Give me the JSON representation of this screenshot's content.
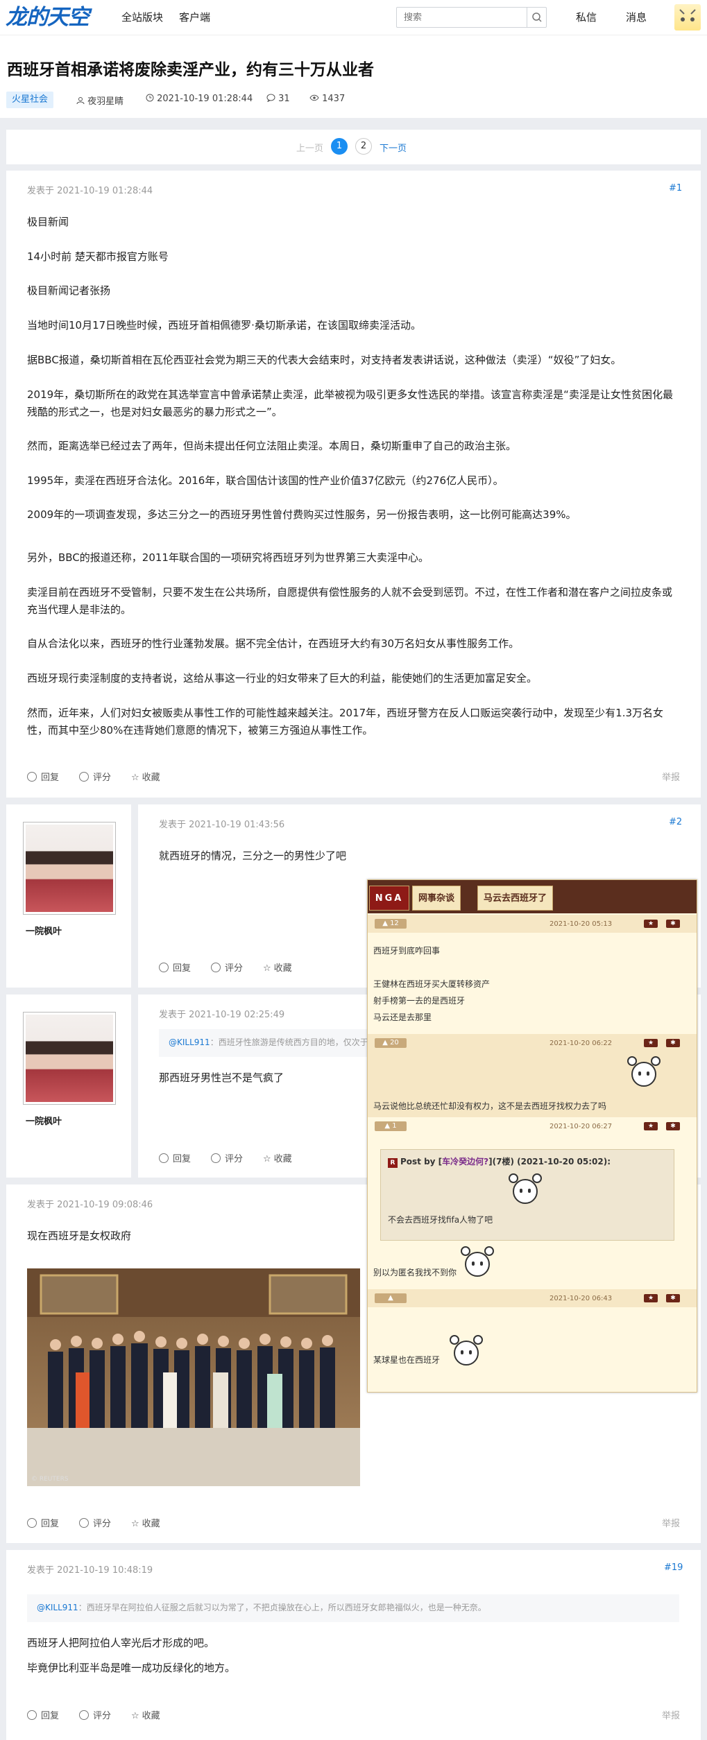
{
  "header": {
    "logo": "龙的天空",
    "nav": [
      "全站版块",
      "客户端"
    ],
    "search_placeholder": "搜索",
    "right": [
      "私信",
      "消息"
    ]
  },
  "thread": {
    "title": "西班牙首相承诺将废除卖淫产业，约有三十万从业者",
    "tag": "火星社会",
    "author": "夜羽星睛",
    "time": "2021-10-19 01:28:44",
    "replies": "31",
    "views": "1437"
  },
  "pager": {
    "prev": "上一页",
    "pages": [
      "1",
      "2"
    ],
    "next": "下一页"
  },
  "actions": {
    "reply": "回复",
    "rate": "评分",
    "fav": "收藏",
    "report": "举报"
  },
  "posts": [
    {
      "posted": "发表于 2021-10-19 01:28:44",
      "floor": "#1",
      "paragraphs": [
        "极目新闻",
        "14小时前 楚天都市报官方账号",
        "极目新闻记者张扬",
        "当地时间10月17日晚些时候，西班牙首相佩德罗·桑切斯承诺，在该国取缔卖淫活动。",
        "据BBC报道，桑切斯首相在瓦伦西亚社会党为期三天的代表大会结束时，对支持者发表讲话说，这种做法（卖淫）“奴役”了妇女。",
        "2019年，桑切斯所在的政党在其选举宣言中曾承诺禁止卖淫，此举被视为吸引更多女性选民的举措。该宣言称卖淫是“卖淫是让女性贫困化最残酷的形式之一，也是对妇女最恶劣的暴力形式之一”。",
        "然而，距离选举已经过去了两年，但尚未提出任何立法阻止卖淫。本周日，桑切斯重申了自己的政治主张。",
        "1995年，卖淫在西班牙合法化。2016年，联合国估计该国的性产业价值37亿欧元（约276亿人民币）。",
        "2009年的一项调查发现，多达三分之一的西班牙男性曾付费购买过性服务，另一份报告表明，这一比例可能高达39%。",
        "另外，BBC的报道还称，2011年联合国的一项研究将西班牙列为世界第三大卖淫中心。",
        "卖淫目前在西班牙不受管制，只要不发生在公共场所，自愿提供有偿性服务的人就不会受到惩罚。不过，在性工作者和潜在客户之间拉皮条或充当代理人是非法的。",
        "自从合法化以来，西班牙的性行业蓬勃发展。据不完全估计，在西班牙大约有30万名妇女从事性服务工作。",
        "西班牙现行卖淫制度的支持者说，这给从事这一行业的妇女带来了巨大的利益，能使她们的生活更加富足安全。",
        "然而，近年来，人们对妇女被贩卖从事性工作的可能性越来越关注。2017年，西班牙警方在反人口贩运突袭行动中，发现至少有1.3万名女性，而其中至少80%在违背她们意愿的情况下，被第三方强迫从事性工作。"
      ]
    },
    {
      "user": "一院枫叶",
      "posted": "发表于 2021-10-19 01:43:56",
      "floor": "#2",
      "text": "就西班牙的情况，三分之一的男性少了吧"
    },
    {
      "user": "一院枫叶",
      "posted": "发表于 2021-10-19 02:25:49",
      "quote_at": "@KILL911",
      "quote": "：西班牙性旅游是传统西方目的地，仅次于",
      "text": "那西班牙男性岂不是气疯了"
    },
    {
      "posted": "发表于 2021-10-19 09:08:46",
      "text": "现在西班牙是女权政府",
      "photo_credit": "© REUTERS"
    },
    {
      "posted": "发表于 2021-10-19 10:48:19",
      "floor": "#19",
      "quote_at": "@KILL911",
      "quote": "：西班牙早在阿拉伯人征服之后就习以为常了，不把贞操放在心上，所以西班牙女郎艳福似火，也是一种无奈。",
      "lines": [
        "西班牙人把阿拉伯人宰光后才形成的吧。",
        "毕竟伊比利亚半岛是唯一成功反绿化的地方。"
      ]
    }
  ],
  "nga": {
    "logo": "NGA",
    "tabs": [
      "网事杂谈",
      "马云去西班牙了"
    ],
    "rows": [
      {
        "likes": "12",
        "time": "2021-10-20 05:13",
        "lines": [
          "西班牙到底咋回事",
          "",
          "王健林在西班牙买大厦转移资产",
          "射手榜第一去的是西班牙",
          "马云还是去那里"
        ]
      },
      {
        "likes": "20",
        "time": "2021-10-20 06:22",
        "lines": [
          "马云说他比总统还忙却没有权力，这不是去西班牙找权力去了吗"
        ]
      },
      {
        "likes": "1",
        "time": "2021-10-20 06:27",
        "quote_head": "Post by [",
        "quote_user": "车冷癸边何?",
        "quote_meta": "](7楼) (2021-10-20 05:02):",
        "quote_text": "不会去西班牙找fifa人物了吧",
        "lines": [
          "别以为匿名我找不到你"
        ]
      },
      {
        "likes": "",
        "time": "2021-10-20 06:43",
        "lines": [
          "某球星也在西班牙"
        ]
      }
    ]
  }
}
